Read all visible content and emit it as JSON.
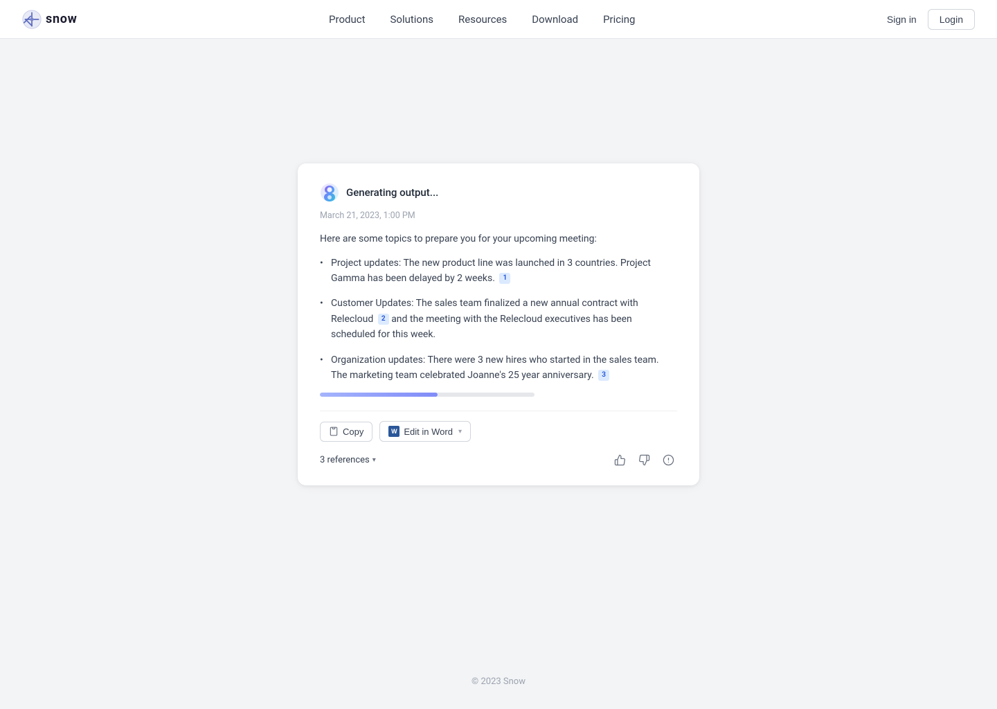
{
  "navbar": {
    "logo_text": "snow",
    "nav_items": [
      {
        "label": "Product",
        "id": "product"
      },
      {
        "label": "Solutions",
        "id": "solutions"
      },
      {
        "label": "Resources",
        "id": "resources"
      },
      {
        "label": "Download",
        "id": "download"
      },
      {
        "label": "Pricing",
        "id": "pricing"
      }
    ],
    "sign_in_label": "Sign in",
    "login_label": "Login"
  },
  "card": {
    "generating_label": "Generating output...",
    "timestamp": "March 21, 2023, 1:00 PM",
    "intro": "Here are some topics to prepare you for your upcoming meeting:",
    "bullets": [
      {
        "text": "Project updates: The new product line was launched in 3 countries. Project Gamma has been delayed by 2 weeks.",
        "ref": "1"
      },
      {
        "text": "Customer Updates: The sales team finalized a new annual contract with Relecloud",
        "ref": "2",
        "text2": " and the meeting with the Relecloud executives has been scheduled for this week."
      },
      {
        "text": "Organization updates: There were 3 new hires who started in the sales team. The marketing team celebrated Joanne's 25 year anniversary.",
        "ref": "3"
      }
    ],
    "copy_label": "Copy",
    "edit_word_label": "Edit in Word",
    "references_label": "3 references",
    "word_icon": "W"
  },
  "footer": {
    "text": "© 2023 Snow"
  }
}
